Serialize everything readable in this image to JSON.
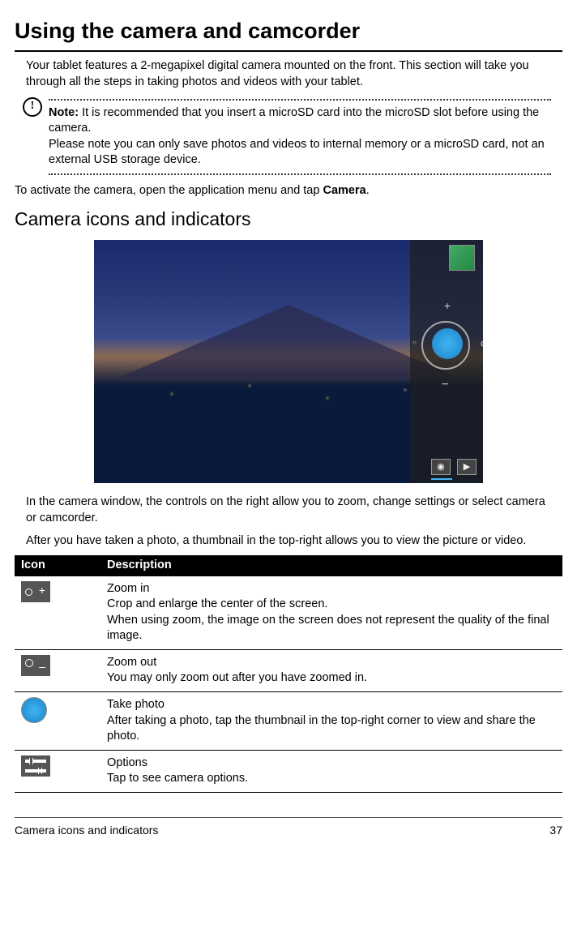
{
  "title": "Using the camera and camcorder",
  "intro": "Your tablet features a 2-megapixel digital camera mounted on the front. This section will take you through all the steps in taking photos and videos with your tablet.",
  "note_label": "Note:",
  "note_body1": " It is recommended that you insert a microSD card into the microSD slot before using the camera.",
  "note_body2": "Please note you can only save photos and videos to internal memory or a microSD card, not an external USB storage device.",
  "activate_prefix": "To activate the camera, open the application menu and tap ",
  "activate_bold": "Camera",
  "activate_suffix": ".",
  "section_heading": "Camera icons and indicators",
  "para_controls": "In the camera window, the controls on the right allow you to zoom, change settings or select camera or camcorder.",
  "para_thumbnail": "After you have taken a photo, a thumbnail in the top-right allows you to view the picture or video.",
  "table": {
    "head_icon": "Icon",
    "head_desc": "Description",
    "rows": [
      {
        "title": "Zoom in",
        "line1": "Crop and enlarge the center of the screen.",
        "line2": "When using zoom, the image on the screen does not represent the quality of the final image."
      },
      {
        "title": "Zoom out",
        "line1": "You may only zoom out after you have zoomed in.",
        "line2": ""
      },
      {
        "title": "Take photo",
        "line1": "After taking a photo, tap the thumbnail in the top-right corner to view and share the photo.",
        "line2": ""
      },
      {
        "title": "Options",
        "line1": "Tap to see camera options.",
        "line2": ""
      }
    ]
  },
  "footer_left": "Camera icons and indicators",
  "footer_right": "37"
}
